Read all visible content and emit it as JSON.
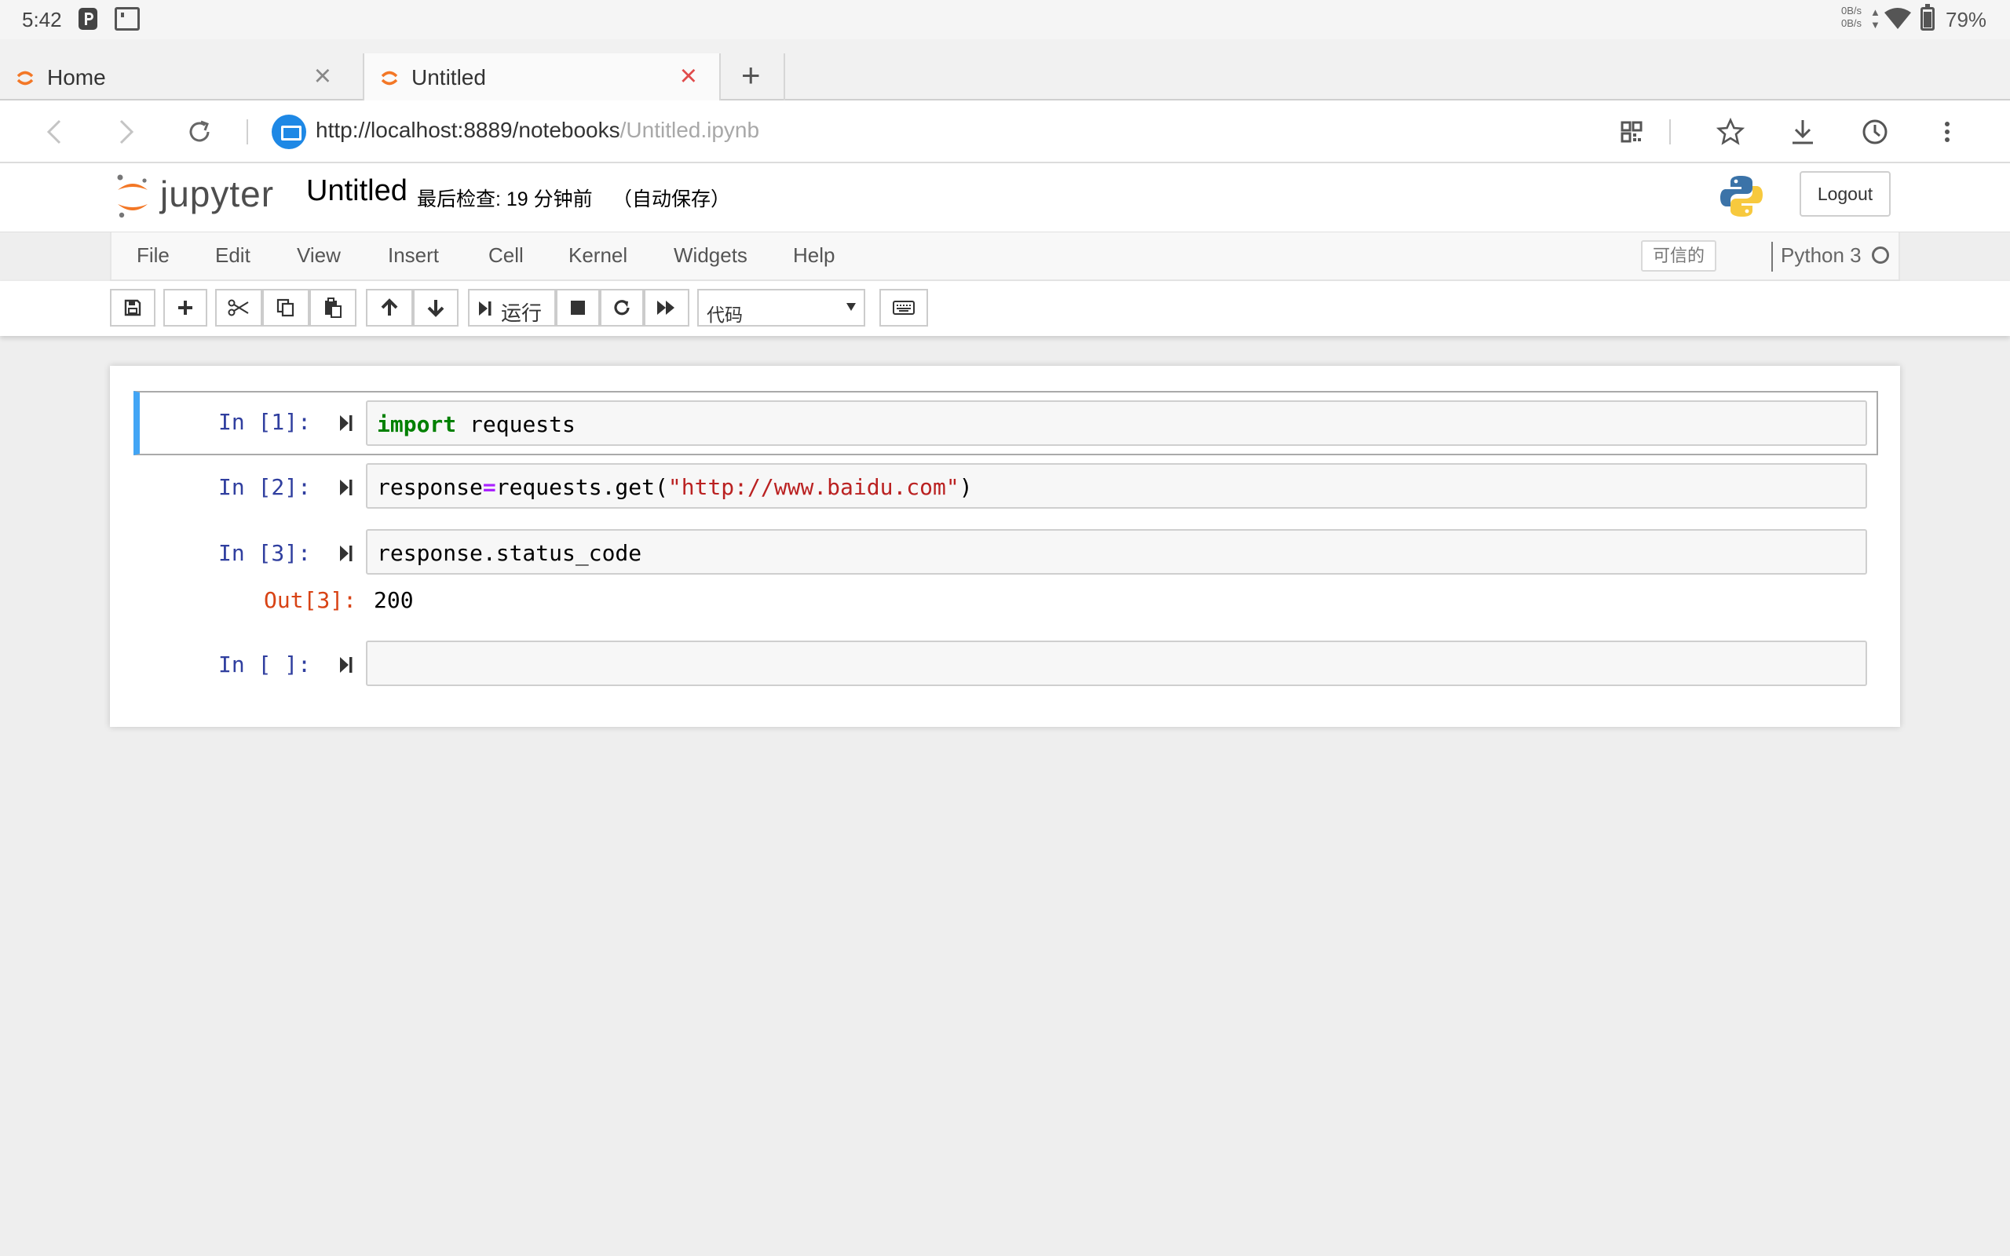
{
  "status_bar": {
    "time": "5:42",
    "net_up": "0B/s",
    "net_down": "0B/s",
    "battery": "79%"
  },
  "browser": {
    "tabs": [
      {
        "label": "Home",
        "active": false
      },
      {
        "label": "Untitled",
        "active": true
      }
    ],
    "url_main": "http://localhost:8889/notebooks",
    "url_dim": "/Untitled.ipynb",
    "site_icon": "monitor-icon"
  },
  "jupyter": {
    "logo_text": "jupyter",
    "notebook_title": "Untitled",
    "last_checkpoint": "最后检查: 19 分钟前",
    "autosave": "（自动保存）",
    "logout_label": "Logout",
    "menu": [
      "File",
      "Edit",
      "View",
      "Insert",
      "Cell",
      "Kernel",
      "Widgets",
      "Help"
    ],
    "trusted_label": "可信的",
    "kernel_name": "Python 3",
    "toolbar": {
      "run_label": "运行",
      "cell_type": "代码"
    }
  },
  "cells": [
    {
      "prompt": "In [1]:",
      "code": {
        "keyword": "import",
        "rest": " requests"
      }
    },
    {
      "prompt": "In [2]:",
      "code": {
        "pre": "response",
        "op": "=",
        "mid": "requests.get(",
        "str": "\"http://www.baidu.com\"",
        "post": ")"
      }
    },
    {
      "prompt": "In [3]:",
      "code": {
        "text": "response.status_code"
      },
      "output": {
        "prompt": "Out[3]:",
        "value": "200"
      }
    },
    {
      "prompt": "In [ ]:",
      "code": {
        "text": ""
      }
    }
  ],
  "colors": {
    "jupyter_orange": "#f37726",
    "selected_cell_bar": "#42a5f5",
    "prompt_in": "#303f9f",
    "prompt_out": "#d84315",
    "keyword": "#008000",
    "string": "#ba2121",
    "operator": "#aa22ff",
    "tab_close_active": "#e04b4b",
    "site_badge": "#1e88e5"
  }
}
